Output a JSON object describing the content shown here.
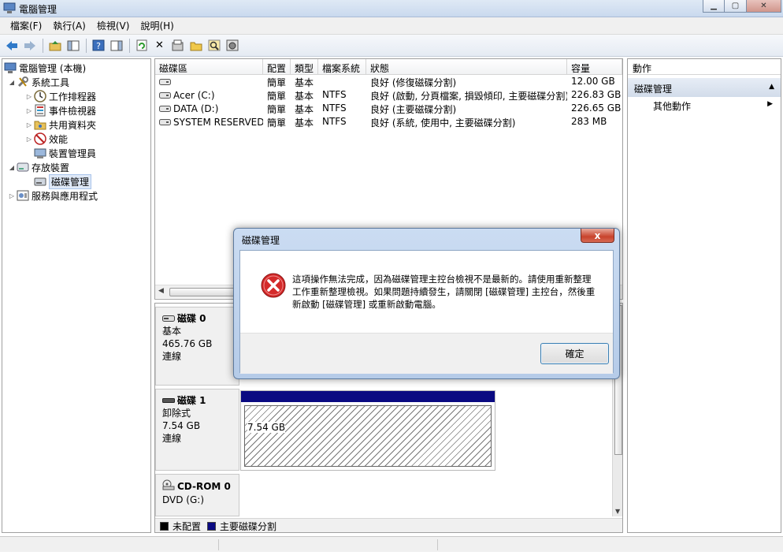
{
  "window": {
    "title": "電腦管理"
  },
  "menu": [
    "檔案(F)",
    "執行(A)",
    "檢視(V)",
    "說明(H)"
  ],
  "tree": {
    "root": "電腦管理 (本機)",
    "system_tools": "系統工具",
    "task_scheduler": "工作排程器",
    "event_viewer": "事件檢視器",
    "shared_folders": "共用資料夾",
    "performance": "效能",
    "device_manager": "裝置管理員",
    "storage": "存放裝置",
    "disk_management": "磁碟管理",
    "services_apps": "服務與應用程式"
  },
  "volumes": {
    "columns": [
      "磁碟區",
      "配置",
      "類型",
      "檔案系統",
      "狀態",
      "容量"
    ],
    "rows": [
      {
        "name": "",
        "layout": "簡單",
        "type": "基本",
        "fs": "",
        "status": "良好 (修復磁碟分割)",
        "capacity": "12.00 GB"
      },
      {
        "name": "Acer (C:)",
        "layout": "簡單",
        "type": "基本",
        "fs": "NTFS",
        "status": "良好 (啟動, 分頁檔案, 損毀傾印, 主要磁碟分割)",
        "capacity": "226.83 GB"
      },
      {
        "name": "DATA (D:)",
        "layout": "簡單",
        "type": "基本",
        "fs": "NTFS",
        "status": "良好 (主要磁碟分割)",
        "capacity": "226.65 GB"
      },
      {
        "name": "SYSTEM RESERVED",
        "layout": "簡單",
        "type": "基本",
        "fs": "NTFS",
        "status": "良好 (系統, 使用中, 主要磁碟分割)",
        "capacity": "283 MB"
      }
    ]
  },
  "disks": {
    "disk0": {
      "name": "磁碟 0",
      "type": "基本",
      "size": "465.76 GB",
      "status": "連線"
    },
    "disk1": {
      "name": "磁碟 1",
      "type": "卸除式",
      "size": "7.54 GB",
      "status": "連線",
      "partition_size": "7.54 GB"
    },
    "cdrom0": {
      "name": "CD-ROM 0",
      "type": "DVD (G:)"
    }
  },
  "legend": {
    "unallocated": "未配置",
    "primary": "主要磁碟分割",
    "unallocated_color": "#000000",
    "primary_color": "#0a0a82"
  },
  "actions": {
    "header": "動作",
    "section": "磁碟管理",
    "more": "其他動作"
  },
  "dialog": {
    "title": "磁碟管理",
    "close": "x",
    "message": "這項操作無法完成，因為磁碟管理主控台檢視不是最新的。請使用重新整理工作重新整理檢視。如果問題持續發生，請關閉 [磁碟管理] 主控台，然後重新啟動 [磁碟管理] 或重新啟動電腦。",
    "ok": "確定"
  }
}
